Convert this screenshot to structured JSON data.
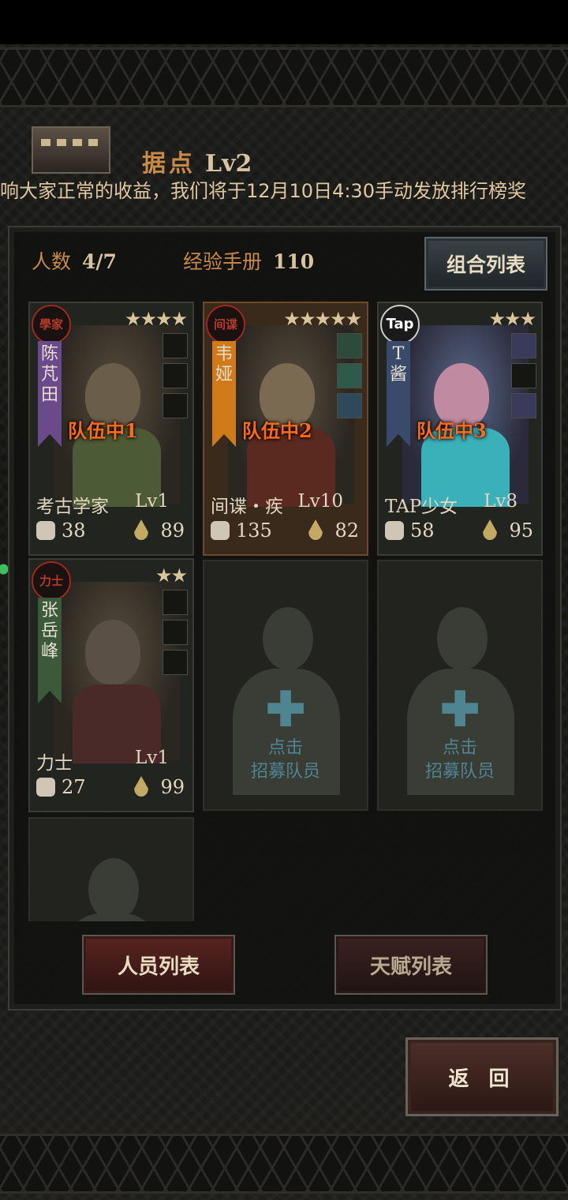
{
  "header": {
    "title": "据点",
    "level": "Lv2",
    "notice": "响大家正常的收益，我们将于12月10日4:30手动发放排行榜奖"
  },
  "stats": {
    "population_label": "人数",
    "population_value": "4/7",
    "exp_label": "经验手册",
    "exp_value": "110",
    "combo_button": "组合列表"
  },
  "members": [
    {
      "badge": "學家",
      "name_vertical": "陈芃田",
      "stars": "★★★★",
      "team": "队伍中1",
      "class": "考古学家",
      "level": "Lv1",
      "power": "38",
      "stamina": "89",
      "ribbon_color": "#6a4a8a"
    },
    {
      "badge": "间谍",
      "name_vertical": "韦娅",
      "stars": "★★★★★",
      "team": "队伍中2",
      "class": "间谍・疾",
      "level": "Lv10",
      "power": "135",
      "stamina": "82",
      "ribbon_color": "#d07a1a"
    },
    {
      "badge": "Tap",
      "name_vertical": "T酱",
      "stars": "★★★",
      "team": "队伍中3",
      "class": "TAP少女",
      "level": "Lv8",
      "power": "58",
      "stamina": "95",
      "ribbon_color": "#3a4a6a"
    },
    {
      "badge": "力士",
      "name_vertical": "张岳峰",
      "stars": "★★",
      "team": "",
      "class": "力士",
      "level": "Lv1",
      "power": "27",
      "stamina": "99",
      "ribbon_color": "#3a5a3a"
    }
  ],
  "recruit_slots": [
    {
      "line1": "点击",
      "line2": "招募队员"
    },
    {
      "line1": "点击",
      "line2": "招募队员"
    }
  ],
  "tabs": {
    "members": "人员列表",
    "talents": "天赋列表"
  },
  "back_button": "返 回"
}
